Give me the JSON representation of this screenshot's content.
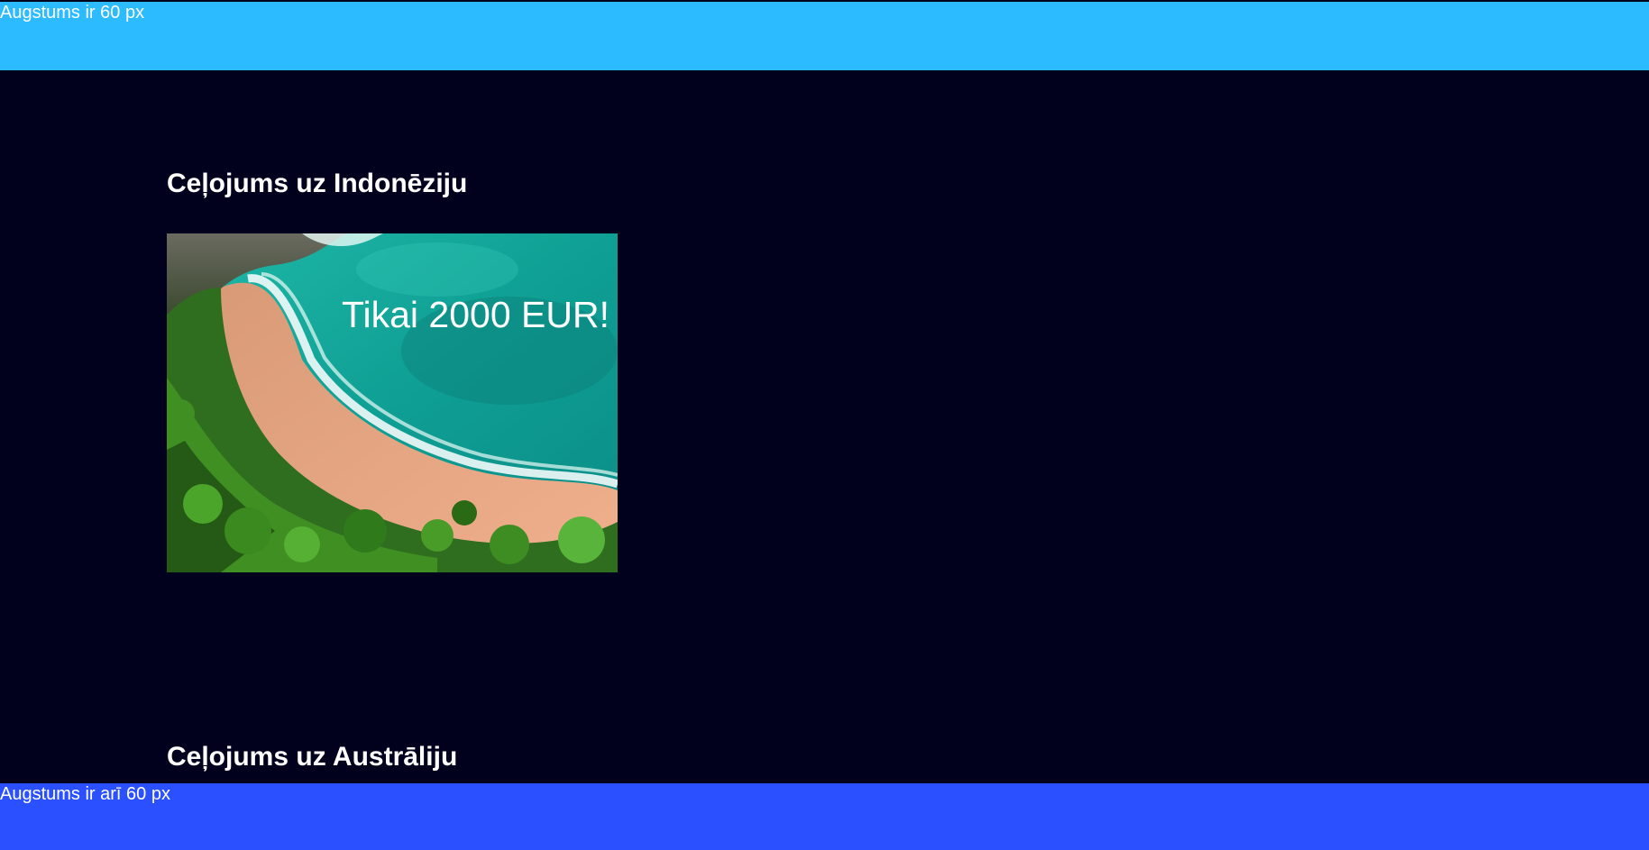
{
  "header": {
    "text": "Augstums ir 60 px",
    "color": "#2cbbff"
  },
  "main": {
    "background": "#01001d",
    "trips": [
      {
        "title": "Ceļojums uz Indonēziju",
        "promo_text": "Tikai 2000 EUR!",
        "image": "tropical-beach-photo"
      },
      {
        "title": "Ceļojums uz Austrāliju"
      }
    ]
  },
  "footer": {
    "text": "Augstums ir arī 60 px",
    "color": "#2a50ff"
  }
}
